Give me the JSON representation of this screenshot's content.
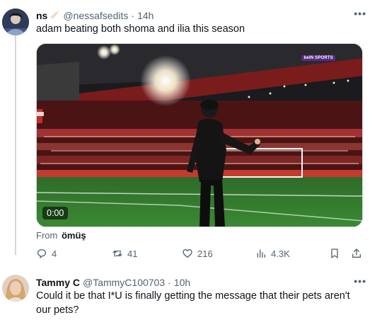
{
  "tweet": {
    "display_name": "ns",
    "handle": "@nessafsedits",
    "separator": "·",
    "time": "14h",
    "text": "adam beating both shoma and ilia this season",
    "video": {
      "timecode": "0:00",
      "watermark": "beIN SPORTS"
    },
    "from_label": "From",
    "from_source": "ömüş",
    "actions": {
      "replies": "4",
      "retweets": "41",
      "likes": "216",
      "views": "4.3K"
    }
  },
  "reply": {
    "display_name": "Tammy C",
    "handle": "@TammyC100703",
    "separator": "·",
    "time": "10h",
    "text": "Could it be that I*U is finally getting the message that their pets aren't our pets?"
  },
  "icons": {
    "more": "more-horizontal-icon",
    "reply": "reply-icon",
    "retweet": "retweet-icon",
    "like": "heart-icon",
    "views": "views-chart-icon",
    "bookmark": "bookmark-icon",
    "share": "share-icon"
  },
  "colors": {
    "text_primary": "#0f1419",
    "text_secondary": "#536471",
    "border": "#cfd9de"
  }
}
